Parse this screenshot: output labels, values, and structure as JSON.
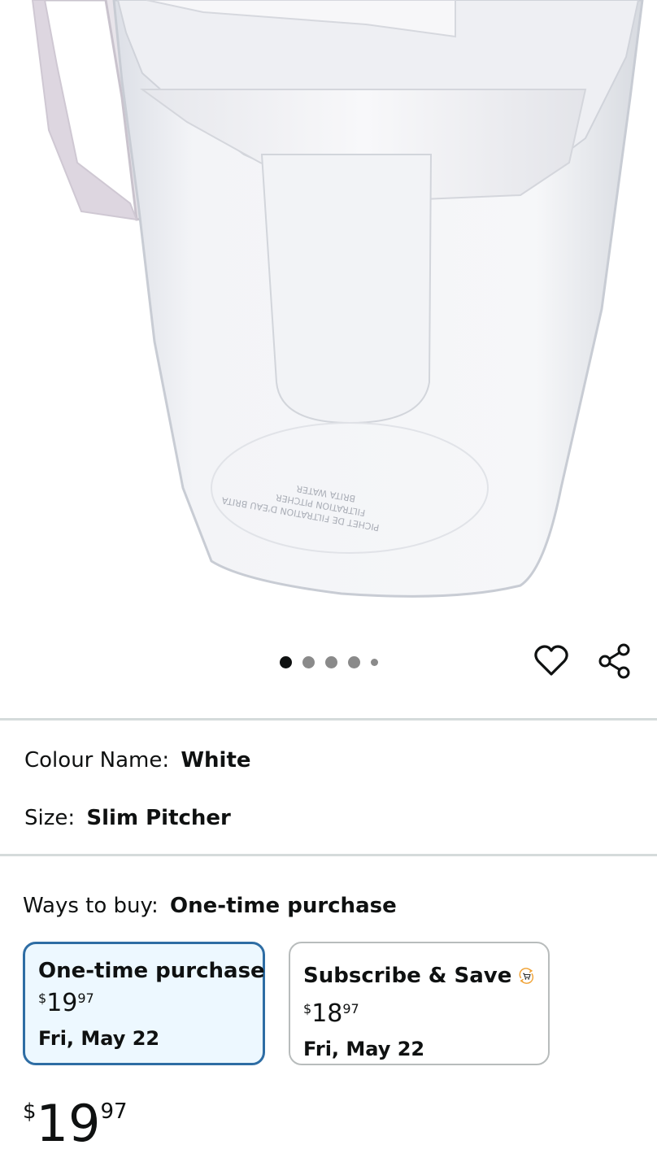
{
  "product": {
    "image_icon": "water-pitcher-image",
    "image_imprint": [
      "BRITA WATER",
      "FILTRATION PITCHER",
      "PICHET DE FILTRATION D'EAU BRITA"
    ]
  },
  "carousel": {
    "dot_count": 5,
    "active_index": 0
  },
  "actions": {
    "wishlist_icon": "heart-outline-icon",
    "share_icon": "share-icon"
  },
  "attributes": {
    "colour": {
      "label": "Colour Name:",
      "value": "White"
    },
    "size": {
      "label": "Size:",
      "value": "Slim Pitcher"
    }
  },
  "ways_to_buy": {
    "label": "Ways to buy:",
    "selected": "One-time purchase",
    "options": [
      {
        "title": "One-time purchase",
        "price_symbol": "$",
        "price_whole": "19",
        "price_cents": "97",
        "delivery": "Fri, May 22",
        "selected": true
      },
      {
        "title": "Subscribe & Save",
        "icon": "subscribe-cart-icon",
        "price_symbol": "$",
        "price_whole": "18",
        "price_cents": "97",
        "delivery": "Fri, May 22",
        "selected": false
      }
    ]
  },
  "price": {
    "symbol": "$",
    "whole": "19",
    "cents": "97"
  },
  "colors": {
    "selected_border": "#2e6da4",
    "selected_bg": "#edf8ff",
    "subscribe_badge": "#f0a030"
  }
}
